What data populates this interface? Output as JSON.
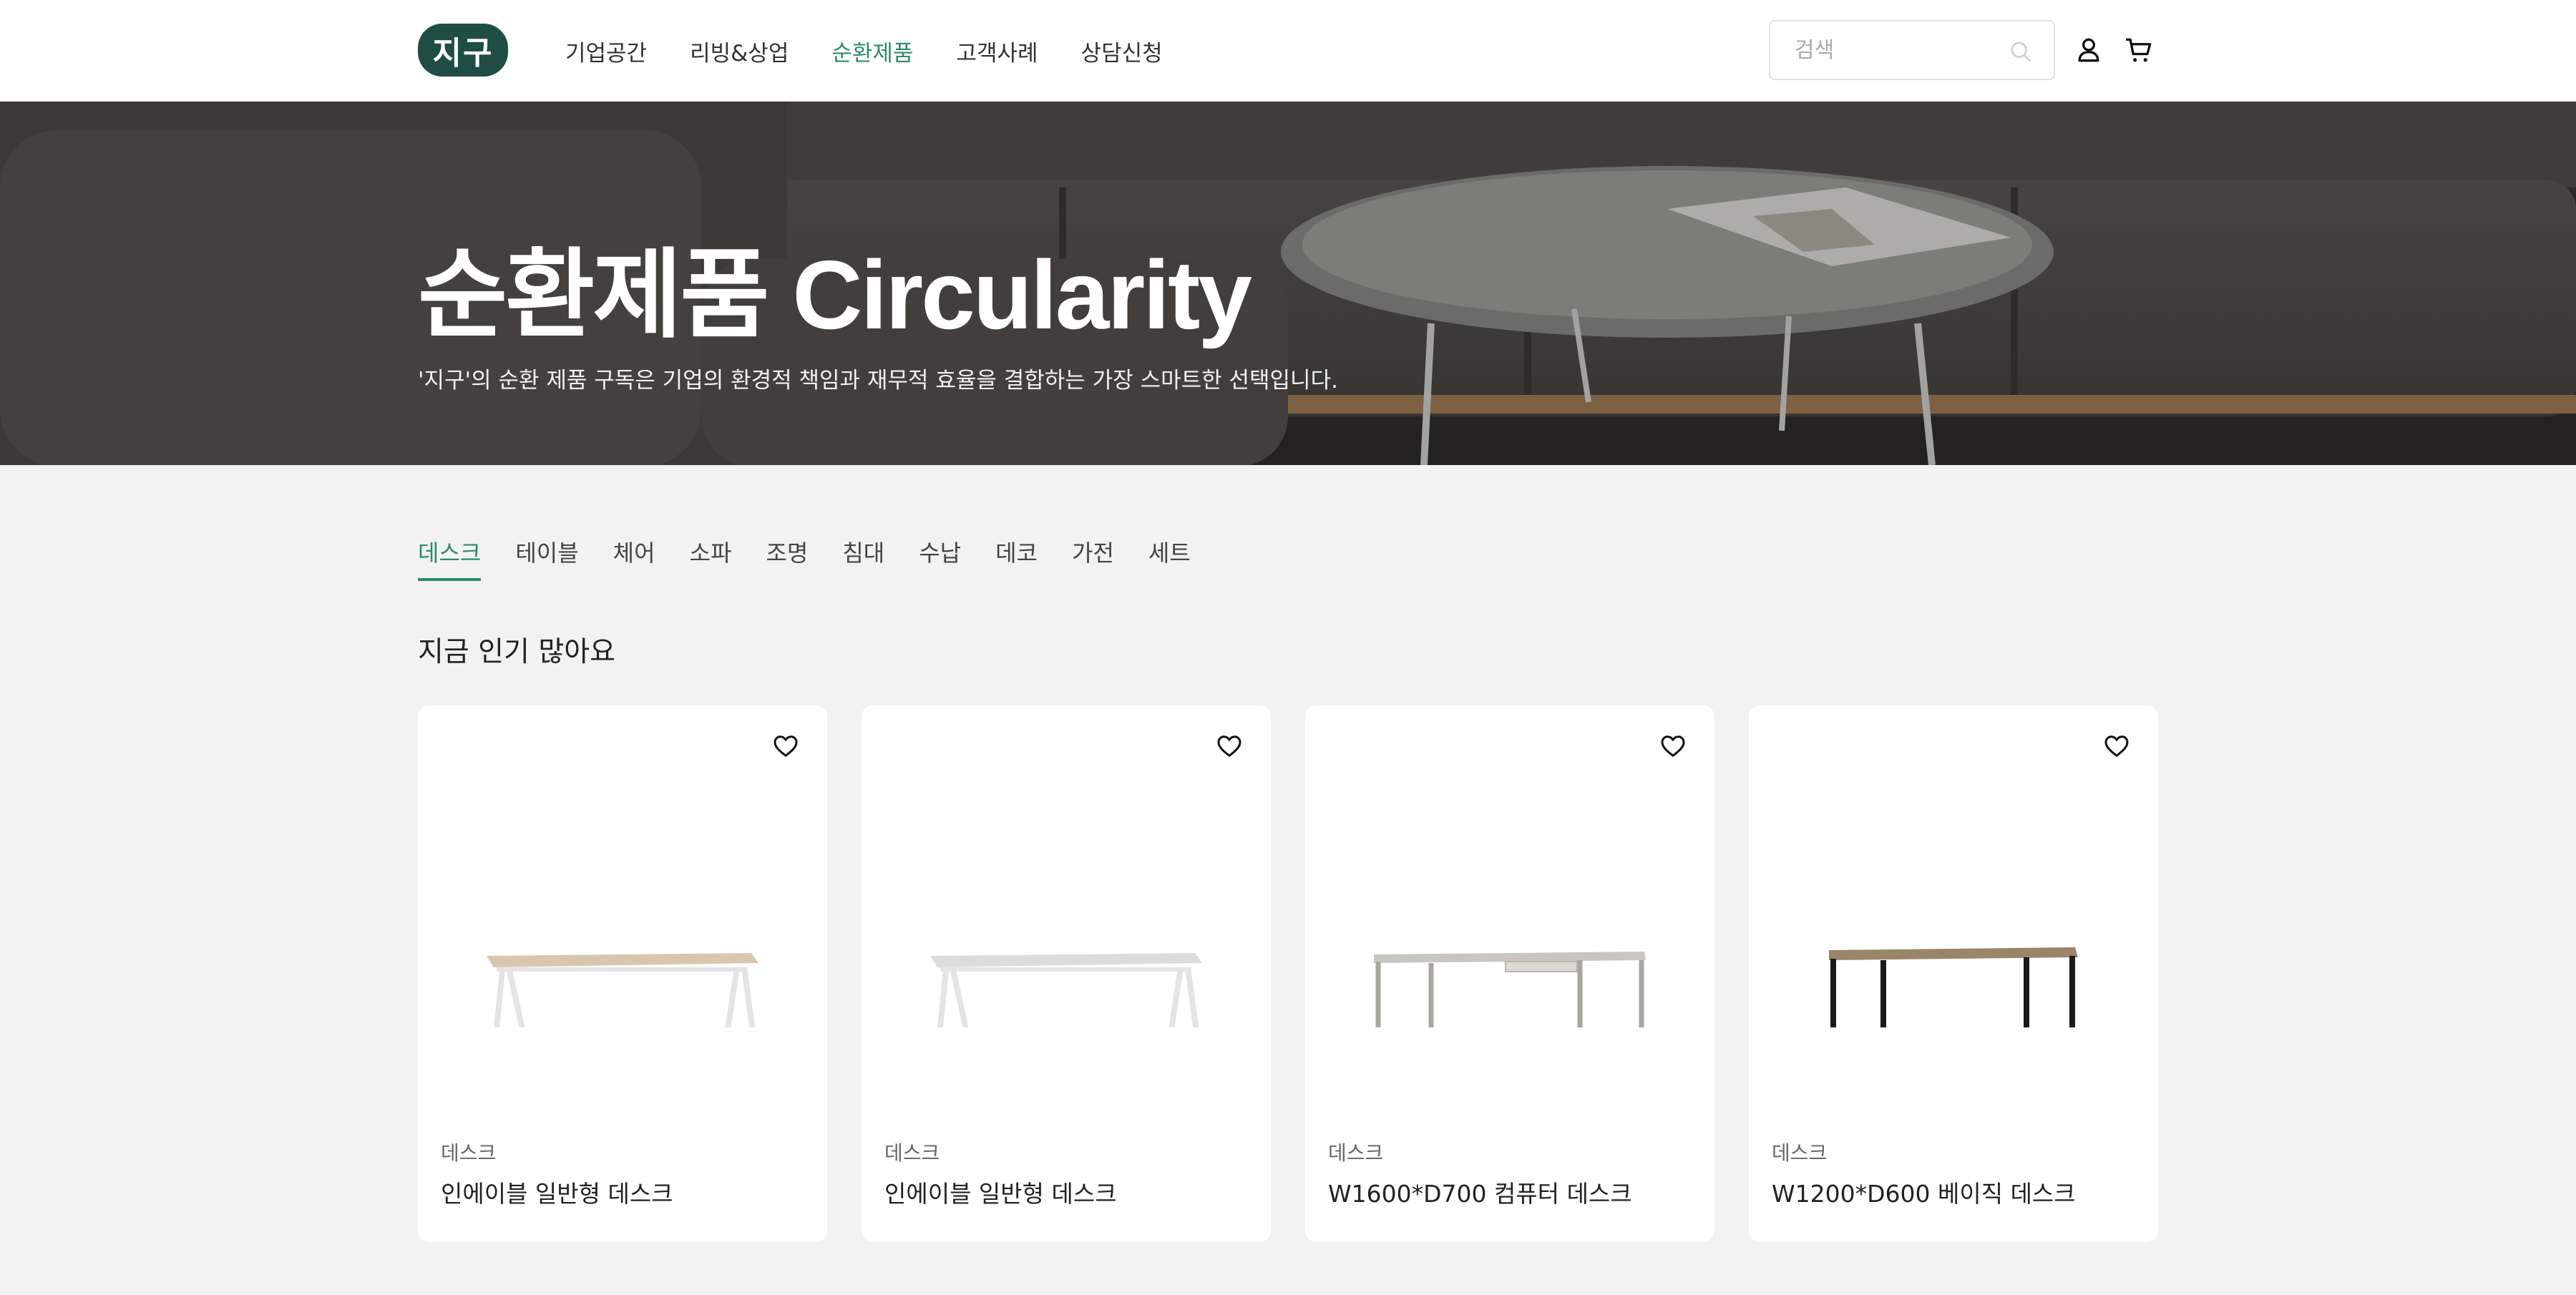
{
  "header": {
    "logo_text": "지구",
    "nav": [
      {
        "label": "기업공간",
        "active": false
      },
      {
        "label": "리빙&상업",
        "active": false
      },
      {
        "label": "순환제품",
        "active": true
      },
      {
        "label": "고객사례",
        "active": false
      },
      {
        "label": "상담신청",
        "active": false
      }
    ],
    "search": {
      "placeholder": "검색",
      "value": ""
    },
    "icons": [
      "search-icon",
      "user-icon",
      "cart-icon"
    ]
  },
  "hero": {
    "title": "순환제품 Circularity",
    "subtitle": "'지구'의 순환 제품 구독은 기업의 환경적 책임과 재무적 효율을 결합하는 가장 스마트한 선택입니다."
  },
  "categories": [
    {
      "label": "데스크",
      "active": true
    },
    {
      "label": "테이블",
      "active": false
    },
    {
      "label": "체어",
      "active": false
    },
    {
      "label": "소파",
      "active": false
    },
    {
      "label": "조명",
      "active": false
    },
    {
      "label": "침대",
      "active": false
    },
    {
      "label": "수납",
      "active": false
    },
    {
      "label": "데코",
      "active": false
    },
    {
      "label": "가전",
      "active": false
    },
    {
      "label": "세트",
      "active": false
    }
  ],
  "section": {
    "title": "지금 인기 많아요"
  },
  "products": [
    {
      "category": "데스크",
      "name": "인에이블 일반형 데스크",
      "top_color": "#d9c7ad",
      "leg_color": "#e4e4e4",
      "style": "angled"
    },
    {
      "category": "데스크",
      "name": "인에이블 일반형 데스크",
      "top_color": "#dcdcdc",
      "leg_color": "#e4e4e4",
      "style": "angled"
    },
    {
      "category": "데스크",
      "name": "W1600*D700 컴퓨터 데스크",
      "top_color": "#c9c6c0",
      "leg_color": "#a9a6a0",
      "style": "straight-drawer"
    },
    {
      "category": "데스크",
      "name": "W1200*D600 베이직 데스크",
      "top_color": "#9c8468",
      "leg_color": "#1a1a1a",
      "style": "straight"
    }
  ],
  "colors": {
    "accent": "#2f8a6e",
    "logo_bg": "#1f4d46"
  }
}
